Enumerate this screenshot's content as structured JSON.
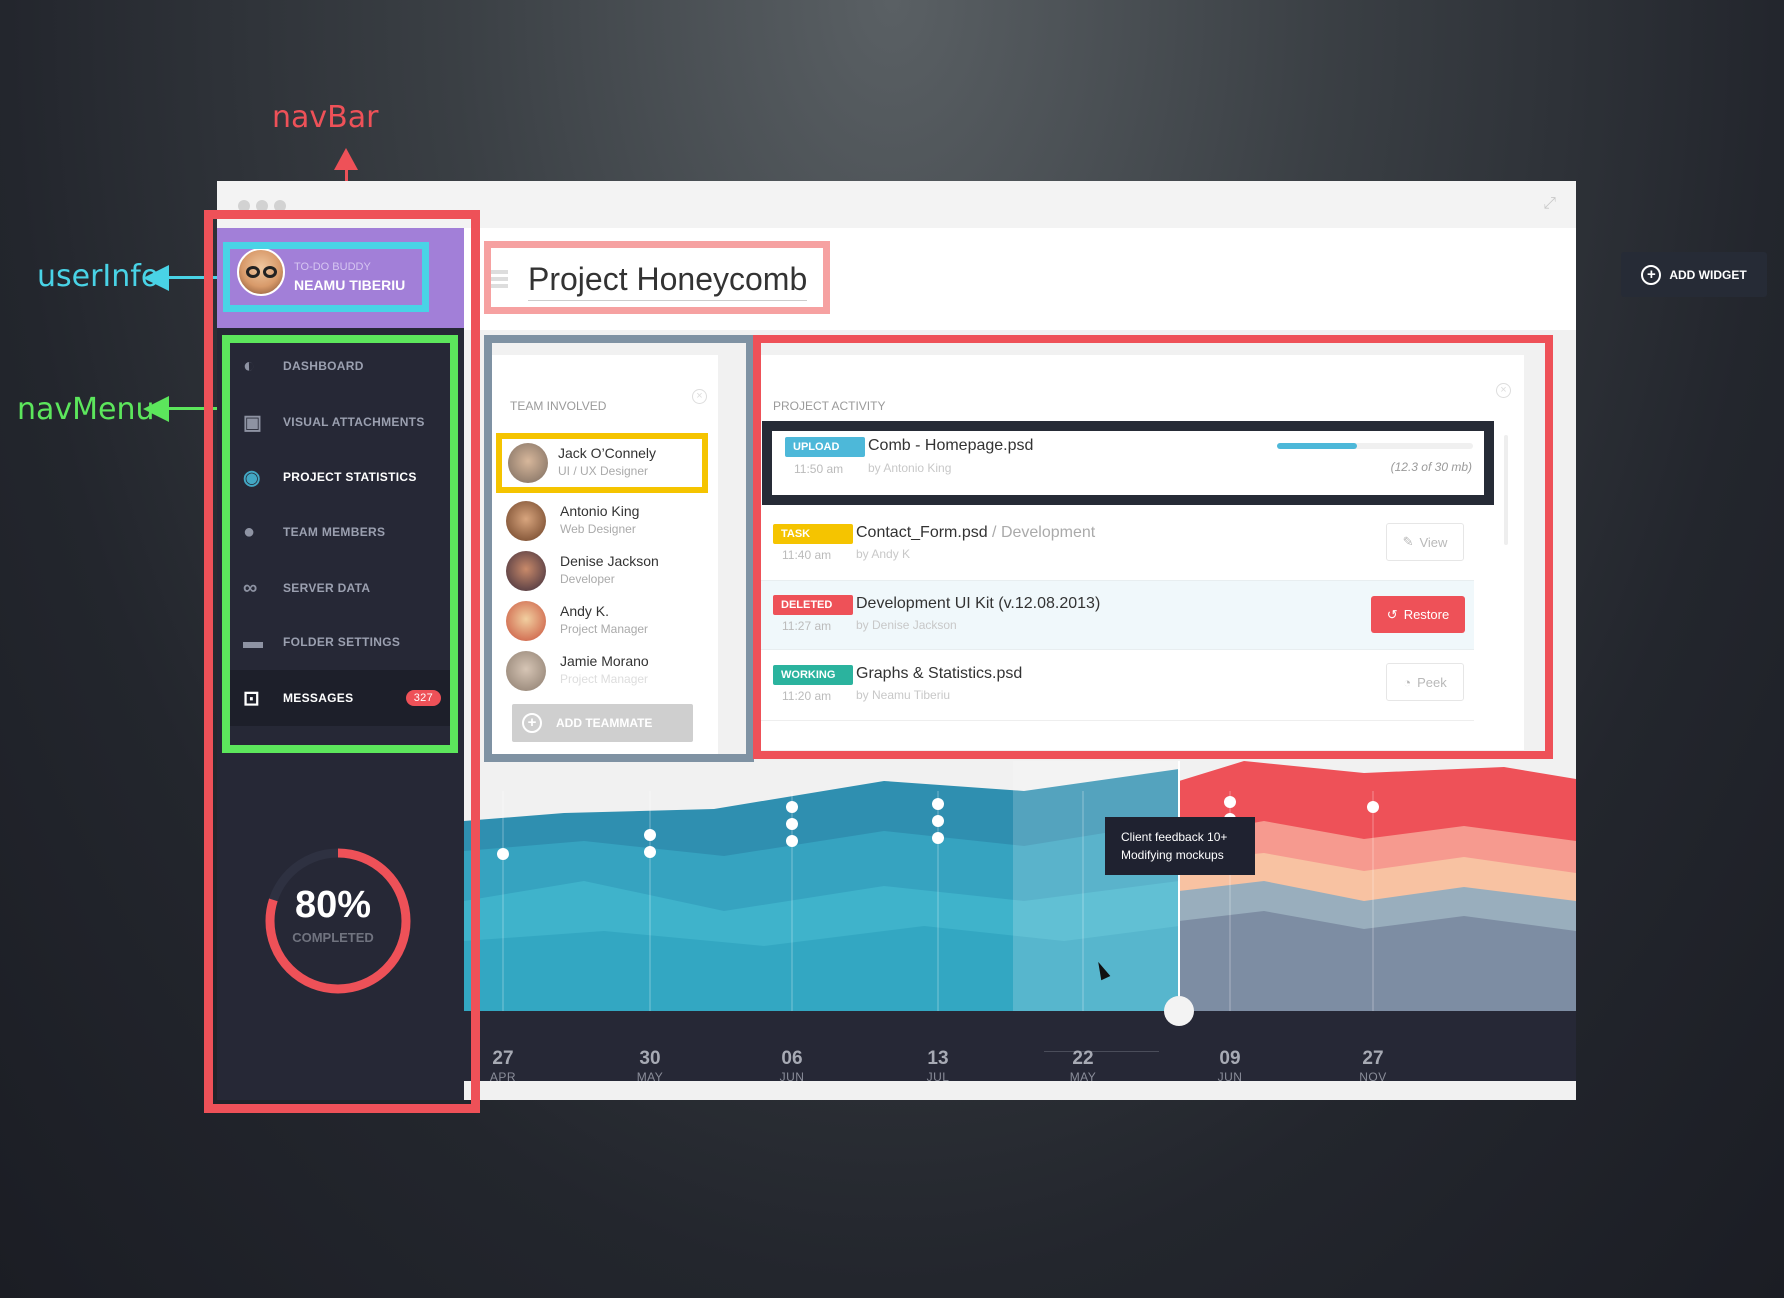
{
  "annotations": {
    "navbar": "navBar",
    "userinfo": "userInfo",
    "navmenu": "navMenu"
  },
  "user": {
    "subtitle": "TO-DO BUDDY",
    "name": "NEAMU TIBERIU"
  },
  "nav": {
    "items": [
      {
        "label": "DASHBOARD",
        "icon": "dashboard-icon"
      },
      {
        "label": "VISUAL ATTACHMENTS",
        "icon": "image-icon"
      },
      {
        "label": "PROJECT STATISTICS",
        "icon": "eye-icon",
        "active": true
      },
      {
        "label": "TEAM MEMBERS",
        "icon": "person-icon"
      },
      {
        "label": "SERVER DATA",
        "icon": "infinity-icon"
      },
      {
        "label": "FOLDER SETTINGS",
        "icon": "folder-icon"
      },
      {
        "label": "MESSAGES",
        "icon": "inbox-icon",
        "badge": "327"
      }
    ]
  },
  "progress": {
    "value": "80%",
    "label": "COMPLETED",
    "fraction": 0.8
  },
  "header": {
    "title": "Project Honeycomb",
    "add_widget": "ADD WIDGET"
  },
  "team": {
    "title": "TEAM INVOLVED",
    "members": [
      {
        "name": "Jack O’Connely",
        "role": "UI / UX Designer"
      },
      {
        "name": "Antonio King",
        "role": "Web Designer"
      },
      {
        "name": "Denise Jackson",
        "role": "Developer"
      },
      {
        "name": "Andy K.",
        "role": "Project Manager"
      },
      {
        "name": "Jamie Morano",
        "role": "Project Manager"
      }
    ],
    "add_button": "ADD TEAMMATE"
  },
  "activity": {
    "title": "PROJECT ACTIVITY",
    "items": [
      {
        "badge": "UPLOAD",
        "time": "11:50 am",
        "file": "Comb - Homepage.psd",
        "suffix": "",
        "by": "by Antonio King",
        "progress_text": "(12.3 of 30 mb)",
        "progress": 0.41
      },
      {
        "badge": "TASK",
        "time": "11:40 am",
        "file": "Contact_Form.psd",
        "suffix": " / Development",
        "by": "by Andy K",
        "action": "View"
      },
      {
        "badge": "DELETED",
        "time": "11:27 am",
        "file": "Development UI Kit (v.12.08.2013)",
        "suffix": "",
        "by": "by Denise Jackson",
        "action": "Restore"
      },
      {
        "badge": "WORKING",
        "time": "11:20 am",
        "file": "Graphs & Statistics.psd",
        "suffix": "",
        "by": "by Neamu Tiberiu",
        "action": "Peek"
      }
    ]
  },
  "timeline": {
    "tooltip_line1": "Client feedback 10+",
    "tooltip_line2": "Modifying mockups",
    "ticks": [
      {
        "day": "27",
        "month": "APR"
      },
      {
        "day": "30",
        "month": "MAY"
      },
      {
        "day": "06",
        "month": "JUN"
      },
      {
        "day": "13",
        "month": "JUL"
      },
      {
        "day": "22",
        "month": "MAY"
      },
      {
        "day": "09",
        "month": "JUN"
      },
      {
        "day": "27",
        "month": "NOV"
      }
    ]
  },
  "colors": {
    "purple": "#a27fd8",
    "teal": "#3aa6bf",
    "red": "#ee5158",
    "yellow": "#f5c400",
    "green": "#2bb39e"
  }
}
